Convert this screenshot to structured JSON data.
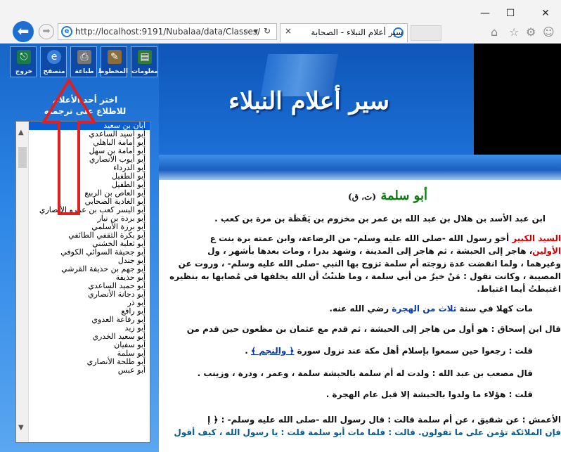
{
  "window": {
    "minimize": "—",
    "maximize": "☐",
    "close": "✕"
  },
  "browser": {
    "url": "http://localhost:9191/Nubalaa/data/Classes/",
    "search_glyph": "⌕",
    "dropdown_glyph": "▾",
    "refresh_glyph": "↻",
    "tab_title": "سير أعلام النبلاء - الصحابة",
    "tab_close": "×",
    "toolbar": [
      "⌂",
      "☆",
      "⚙",
      "☺"
    ]
  },
  "toolbar": [
    {
      "label": "معلومات",
      "icon": "book-icon"
    },
    {
      "label": "المخطوط",
      "icon": "manuscript-icon"
    },
    {
      "label": "طباعة",
      "icon": "printer-icon"
    },
    {
      "label": "متصفح",
      "icon": "browser-icon"
    },
    {
      "label": "خروج",
      "icon": "exit-icon"
    }
  ],
  "banner_title": "سير أعلام النبلاء",
  "prompt": "اختر أحد الأعلام للاطلاع على ترجمته",
  "list": [
    "أبان بن سعيد",
    "أبو أسيد الساعدي",
    "أبو أمامة الباهلي",
    "أبو أمامة بن سهل",
    "أبو أيوب الأنصاري",
    "أبو الدرداء",
    "أبو الطفيل",
    "أبو الطفيل",
    "أبو العاص بن الربيع",
    "أبو الغادية الصحابي",
    "أبو اليسر كعب بن عمرو الأنصاري",
    "أبو بردة بن نيار",
    "أبو برزة الأسلمي",
    "أبو بكرة الثقفي الطائفي",
    "أبو ثعلبة الخشني",
    "أبو جحيفة السوائي الكوفي",
    "أبو جندل",
    "أبو جهم بن حذيفة القرشي",
    "أبو حذيفة",
    "أبو حميد الساعدي",
    "أبو دجانة الأنصاري",
    "أبو ذر",
    "أبو رافع",
    "أبو رفاعة العدوي",
    "أبو زيد",
    "أبو سعيد الخدري",
    "أبو سفيان",
    "أبو سلمة",
    "أبو طلحة الأنصاري",
    "أبو عبس"
  ],
  "content": {
    "heading": "أبو سلمة",
    "heading_tag": "(ت، ق)",
    "p1": "ابن عبد الأسد بن هلال بن عبد الله بن عمر بن مخزوم بن يَقَظَة بن مرة بن كعب .",
    "p2a_red": "السيد الكبير",
    "p2a": " أخو رسول الله -صلى الله عليه وسلم- من الرضاعة، وابن عمته برة بنت ع",
    "p2b_red": "الأولين",
    "p2b": "، هاجر إلى الحبشة ، ثم هاجر إلى المدينة ، وشهد بدرا ، ومات بعدها بأشهر ، ول",
    "p2c": "وغيرهما ، ولما انقضت عدة زوجته أم سلمة تزوج بها النبي -صلى الله عليه وسلم- ، وروت عن",
    "p2d": "المصيبة ، وكانت تقول : مَنْ خيرٌ من أبي سلمة ، وما ظننْتُ أن الله يخلفها في مُصابها به بنظيره",
    "p2e": "اغتبطتُ أيما اغتباط.",
    "p3a": "مات كهلا في سنة ",
    "p3b": "ثلاث من الهجرة",
    "p3c": " رضي الله عنه.",
    "p4": "قال ابن إسحاق : هو أول من هاجر إلى الحبشة ، ثم قدم مع عثمان بن مظعون حين قدم من",
    "p5a": "قلت : رجعوا حين سمعوا بإسلام أهل مكة عند نزول سورة ",
    "p5b": "﴿ والنجم ﴾",
    "p5c": " .",
    "p6": "قال مصعب بن عبد الله : ولدت له أم سلمة بالحبشة سلمة ، وعمر ، ودرة ، وزينب .",
    "p7": "قلت : هؤلاء ما ولدوا بالحبشة إلا قبل عام الهجرة .",
    "p8": "الأعمش : عن شقيق ، عن أم سلمة قالت : قال رسول الله -صلى الله عليه وسلم- : ﴿ إ",
    "p9": "فإن الملائكة تؤمن على ما تقولون. قالت : فلما مات أبو سلمة قلت : يا رسول الله ، كيف أقول"
  },
  "colors": {
    "green": "#0a7a0a",
    "red": "#d00000",
    "blue": "#0a3aa8",
    "teal": "#0a5a8a"
  }
}
